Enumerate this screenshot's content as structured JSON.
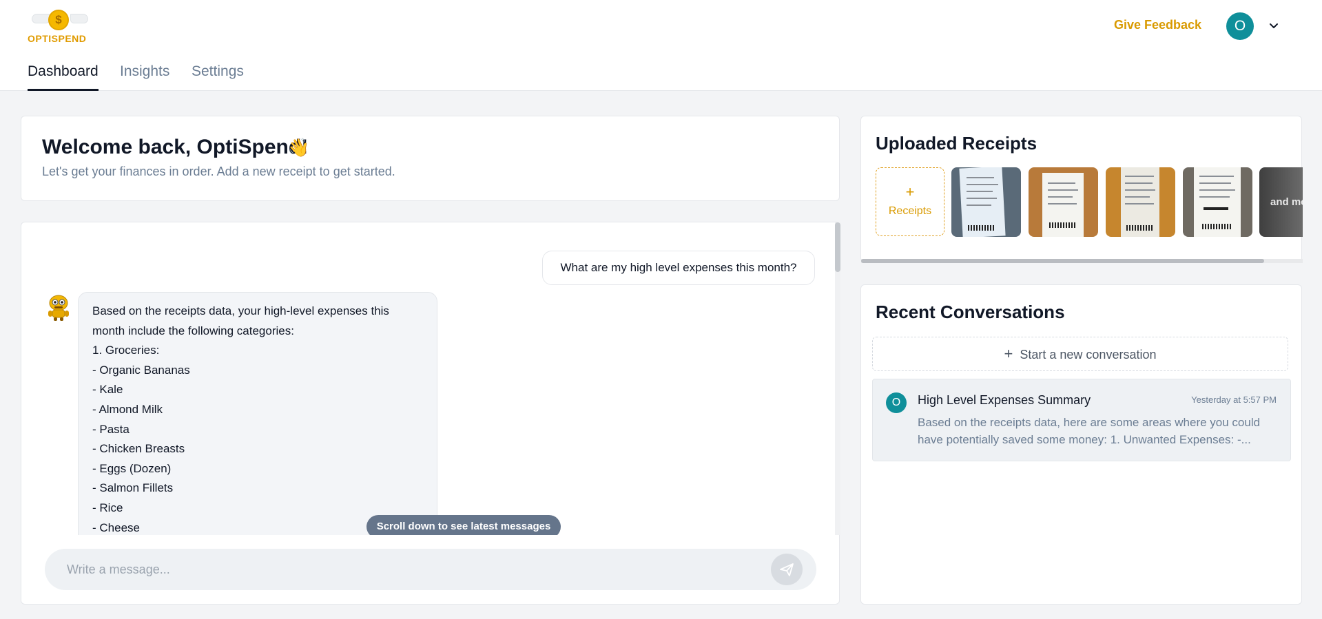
{
  "brand": {
    "name": "OPTISPEND"
  },
  "header": {
    "feedback_label": "Give Feedback",
    "user_initial": "O"
  },
  "nav": {
    "tabs": [
      {
        "label": "Dashboard",
        "active": true
      },
      {
        "label": "Insights",
        "active": false
      },
      {
        "label": "Settings",
        "active": false
      }
    ]
  },
  "welcome": {
    "title": "Welcome back, OptiSpend!",
    "emoji": "👋",
    "subtitle": "Let's get your finances in order. Add a new receipt to get started."
  },
  "chat": {
    "user_message": "What are my high level expenses this month?",
    "bot_lines": [
      "Based on the receipts data, your high-level expenses this",
      "month include the following categories:",
      "1. Groceries:",
      "- Organic Bananas",
      "- Kale",
      "- Almond Milk",
      "- Pasta",
      "- Chicken Breasts",
      "- Eggs (Dozen)",
      "- Salmon Fillets",
      "- Rice",
      "- Cheese"
    ],
    "scroll_hint": "Scroll down to see latest messages",
    "input_placeholder": "Write a message..."
  },
  "receipts": {
    "title": "Uploaded Receipts",
    "add_label": "Receipts",
    "add_symbol": "+",
    "more_label": "and more"
  },
  "recent": {
    "title": "Recent Conversations",
    "new_label": "Start a new conversation",
    "new_symbol": "+",
    "items": [
      {
        "initial": "O",
        "title": "High Level Expenses Summary",
        "time": "Yesterday at 5:57 PM",
        "snippet": "Based on the receipts data, here are some areas where you could have potentially saved some money: 1. Unwanted Expenses: -..."
      }
    ]
  },
  "colors": {
    "accent": "#e09b00",
    "teal": "#0f8f9a",
    "background": "#f3f4f6"
  }
}
